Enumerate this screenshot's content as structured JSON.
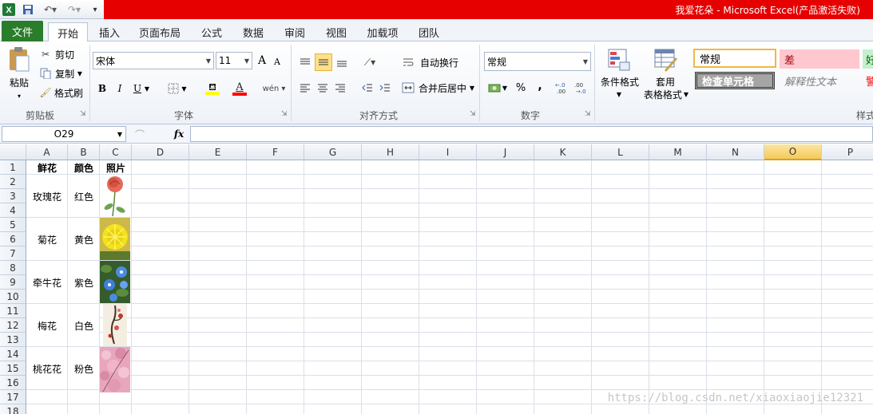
{
  "window": {
    "title": "我爱花朵 -  Microsoft Excel(产品激活失败)"
  },
  "tabs": [
    "文件",
    "开始",
    "插入",
    "页面布局",
    "公式",
    "数据",
    "审阅",
    "视图",
    "加载项",
    "团队"
  ],
  "ribbon": {
    "clipboard": {
      "paste": "粘贴",
      "cut": "剪切",
      "copy": "复制",
      "format_painter": "格式刷",
      "label": "剪贴板"
    },
    "font": {
      "name": "宋体",
      "size": "11",
      "label": "字体",
      "bold": "B",
      "italic": "I",
      "underline": "U",
      "grow": "A",
      "shrink": "A",
      "wen": "wén"
    },
    "alignment": {
      "wrap": "自动换行",
      "merge": "合并后居中",
      "label": "对齐方式"
    },
    "number": {
      "format": "常规",
      "label": "数字",
      "percent": "%",
      "comma": ",",
      "inc_dec": "+.0 .00",
      "dec_dec": ".00 →.0"
    },
    "styles": {
      "conditional": "条件格式",
      "table_l1": "套用",
      "table_l2": "表格格式",
      "normal": "常规",
      "bad": "差",
      "good": "好",
      "check_cell": "检查单元格",
      "explanatory": "解释性文本",
      "warning": "警",
      "label": "样式"
    }
  },
  "formula_bar": {
    "name_box": "O29",
    "fx": "fx"
  },
  "columns": [
    "A",
    "B",
    "C",
    "D",
    "E",
    "F",
    "G",
    "H",
    "I",
    "J",
    "K",
    "L",
    "M",
    "N",
    "O",
    "P"
  ],
  "selected_column": "O",
  "rows": [
    "1",
    "2",
    "3",
    "4",
    "5",
    "6",
    "7",
    "8",
    "9",
    "10",
    "11",
    "12",
    "13",
    "14",
    "15",
    "16",
    "17",
    "18"
  ],
  "table": {
    "headers": [
      "鲜花",
      "颜色",
      "照片"
    ],
    "entries": [
      {
        "flower": "玫瑰花",
        "color": "红色",
        "photo": "rose"
      },
      {
        "flower": "菊花",
        "color": "黄色",
        "photo": "chrysanthemum"
      },
      {
        "flower": "牵牛花",
        "color": "紫色",
        "photo": "morning-glory"
      },
      {
        "flower": "梅花",
        "color": "白色",
        "photo": "plum-blossom"
      },
      {
        "flower": "桃花花",
        "color": "粉色",
        "photo": "peach-blossom"
      }
    ]
  },
  "watermark": "https://blog.csdn.net/xiaoxiaojie12321",
  "colors": {
    "title_red": "#e60000",
    "file_tab": "#2a7d2a",
    "selected_col": "#f5c95a"
  }
}
